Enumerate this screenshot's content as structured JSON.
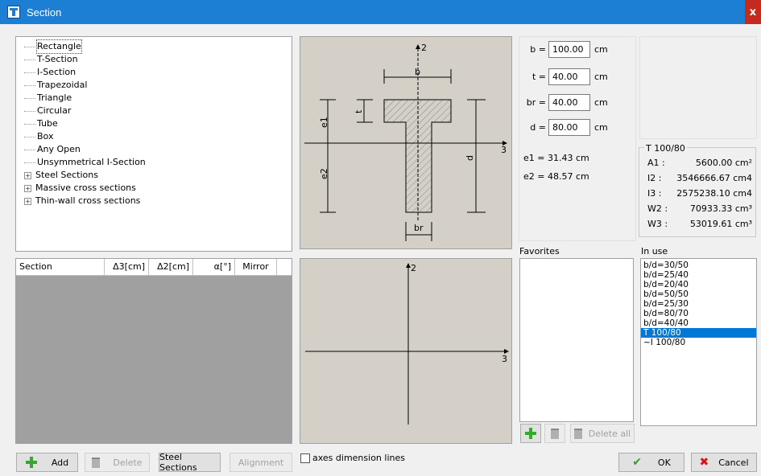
{
  "window": {
    "title": "Section",
    "close": "x"
  },
  "tree": {
    "items": [
      {
        "label": "Rectangle",
        "expandable": false
      },
      {
        "label": "T-Section",
        "expandable": false
      },
      {
        "label": "I-Section",
        "expandable": false
      },
      {
        "label": "Trapezoidal",
        "expandable": false
      },
      {
        "label": "Triangle",
        "expandable": false
      },
      {
        "label": "Circular",
        "expandable": false
      },
      {
        "label": "Tube",
        "expandable": false
      },
      {
        "label": "Box",
        "expandable": false
      },
      {
        "label": "Any Open",
        "expandable": false
      },
      {
        "label": "Unsymmetrical I-Section",
        "expandable": false
      },
      {
        "label": "Steel Sections",
        "expandable": true
      },
      {
        "label": "Massive cross sections",
        "expandable": true
      },
      {
        "label": "Thin-wall cross sections",
        "expandable": true
      }
    ]
  },
  "grid": {
    "columns": [
      "Section",
      "Δ3[cm]",
      "Δ2[cm]",
      "α[°]",
      "Mirror"
    ]
  },
  "drawing_labels": {
    "axis2": "2",
    "axis3": "3",
    "b": "b",
    "t": "t",
    "e1": "e1",
    "e2": "e2",
    "d": "d",
    "br": "br",
    "lower_axis2": "2",
    "lower_axis3": "3"
  },
  "params": {
    "b": {
      "label": "b =",
      "value": "100.00",
      "unit": "cm"
    },
    "t": {
      "label": "t =",
      "value": "40.00",
      "unit": "cm"
    },
    "br": {
      "label": "br =",
      "value": "40.00",
      "unit": "cm"
    },
    "d": {
      "label": "d =",
      "value": "80.00",
      "unit": "cm"
    }
  },
  "results": {
    "e1": "e1 = 31.43 cm",
    "e2": "e2 = 48.57 cm"
  },
  "properties": {
    "title": "T 100/80",
    "rows": [
      {
        "name": "A1 :",
        "value": "5600.00 cm²"
      },
      {
        "name": "I2 :",
        "value": "3546666.67 cm4"
      },
      {
        "name": "I3 :",
        "value": "2575238.10 cm4"
      },
      {
        "name": "W2 :",
        "value": "70933.33 cm³"
      },
      {
        "name": "W3 :",
        "value": "53019.61 cm³"
      }
    ]
  },
  "favorites": {
    "label": "Favorites",
    "delete_all": "Delete all"
  },
  "in_use": {
    "label": "In use",
    "items": [
      "b/d=30/50",
      "b/d=25/40",
      "b/d=20/40",
      "b/d=50/50",
      "b/d=25/30",
      "b/d=80/70",
      "b/d=40/40",
      "T 100/80",
      "~I 100/80"
    ],
    "selected": "T 100/80"
  },
  "buttons": {
    "add": "Add",
    "delete": "Delete",
    "steel_sections": "Steel Sections",
    "alignment": "Alignment",
    "axes_dimension_lines": "axes dimension lines",
    "ok": "OK",
    "cancel": "Cancel"
  },
  "colors": {
    "title_bar": "#1c7fd4",
    "selection": "#0078d7",
    "drawing_bg": "#d4d0c8"
  }
}
